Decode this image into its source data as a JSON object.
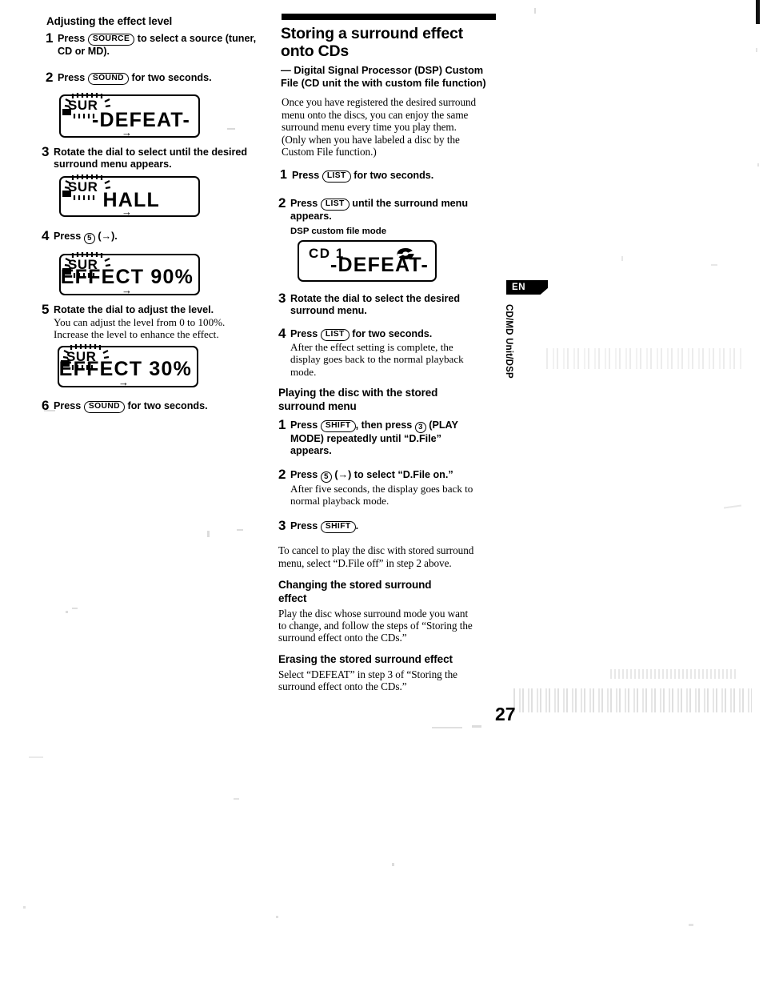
{
  "left_column": {
    "heading": "Adjusting the effect level",
    "steps": [
      {
        "num": "1",
        "lead_pre": "Press",
        "button": "SOURCE",
        "lead_post": "to select a source (tuner,",
        "lead_post2": "CD or MD)."
      },
      {
        "num": "2",
        "lead_pre": "Press",
        "button": "SOUND",
        "lead_post": "for two seconds."
      },
      {
        "num": "3",
        "lead_post": "Rotate the dial to select until the desired",
        "lead_post2": "surround menu appears."
      },
      {
        "num": "4",
        "lead_pre": "Press",
        "button_circle": "5",
        "lead_post": "(→)."
      },
      {
        "num": "5",
        "lead_post": "Rotate the dial to adjust the level.",
        "sub1": "You can adjust the level from 0 to 100%.",
        "sub2": "Increase the level to enhance the effect."
      },
      {
        "num": "6",
        "lead_pre": "Press",
        "button": "SOUND",
        "lead_post": "for two seconds."
      }
    ],
    "displays": [
      {
        "indicator": "SUR",
        "text": "-DEFEAT-"
      },
      {
        "indicator": "SUR",
        "text": "HALL"
      },
      {
        "indicator": "SUR",
        "text": "EFFECT 90%"
      },
      {
        "indicator": "SUR",
        "text": "EFFECT 30%"
      }
    ]
  },
  "right_column": {
    "title_line1": "Storing a surround effect",
    "title_line2": "onto CDs",
    "subtitle_line1": "— Digital Signal Processor (DSP) Custom",
    "subtitle_line2": "File (CD unit the with custom file function)",
    "intro": [
      "Once you have registered the desired surround",
      "menu onto the discs, you can enjoy the same",
      "surround menu every time you play them.",
      "(Only when you have labeled a disc by the",
      "Custom File function.)"
    ],
    "steps": [
      {
        "num": "1",
        "lead_pre": "Press",
        "button": "LIST",
        "lead_post": "for two seconds."
      },
      {
        "num": "2",
        "lead_pre": "Press",
        "button": "LIST",
        "lead_post": "until the surround menu",
        "lead_post2": "appears.",
        "caption": "DSP custom file mode"
      },
      {
        "num": "3",
        "lead_post": "Rotate the dial to select the desired",
        "lead_post2": "surround menu."
      },
      {
        "num": "4",
        "lead_pre": "Press",
        "button": "LIST",
        "lead_post": "for two seconds.",
        "sub1": "After the effect setting is complete, the",
        "sub2": "display goes back to the normal playback",
        "sub3": "mode."
      }
    ],
    "display": {
      "label": "CD 1",
      "text": "-DEFEAT-",
      "icon": "disc-icon"
    },
    "section2": {
      "heading_line1": "Playing the disc with the stored",
      "heading_line2": "surround menu",
      "steps": [
        {
          "num": "1",
          "lead_pre": "Press",
          "button": "SHIFT",
          "lead_post": ", then press",
          "button_circle": "3",
          "lead_post2": "(PLAY",
          "lead_line2": "MODE) repeatedly until “D.File”",
          "lead_line3": "appears."
        },
        {
          "num": "2",
          "lead_pre": "Press",
          "button_circle": "5",
          "lead_post": "(→) to select “D.File on.”",
          "sub1": "After five seconds, the display goes back to",
          "sub2": "normal playback mode."
        },
        {
          "num": "3",
          "lead_pre": "Press",
          "button": "SHIFT",
          "lead_post": "."
        }
      ],
      "note1": "To cancel to play the disc with stored surround",
      "note2": "menu, select “D.File off” in step 2 above."
    },
    "section3": {
      "heading_line1": "Changing the stored surround",
      "heading_line2": "effect",
      "body1": "Play the disc whose surround mode you want",
      "body2": "to change, and follow the steps of “Storing the",
      "body3": "surround effect onto the CDs.”"
    },
    "section4": {
      "heading": "Erasing the stored surround effect",
      "body1": "Select “DEFEAT” in step 3 of “Storing the",
      "body2": "surround effect onto the CDs.”"
    }
  },
  "sidebar": {
    "language_badge": "EN",
    "vertical_label": "CD/MD Unit/DSP"
  },
  "footer": {
    "page_number": "27"
  }
}
